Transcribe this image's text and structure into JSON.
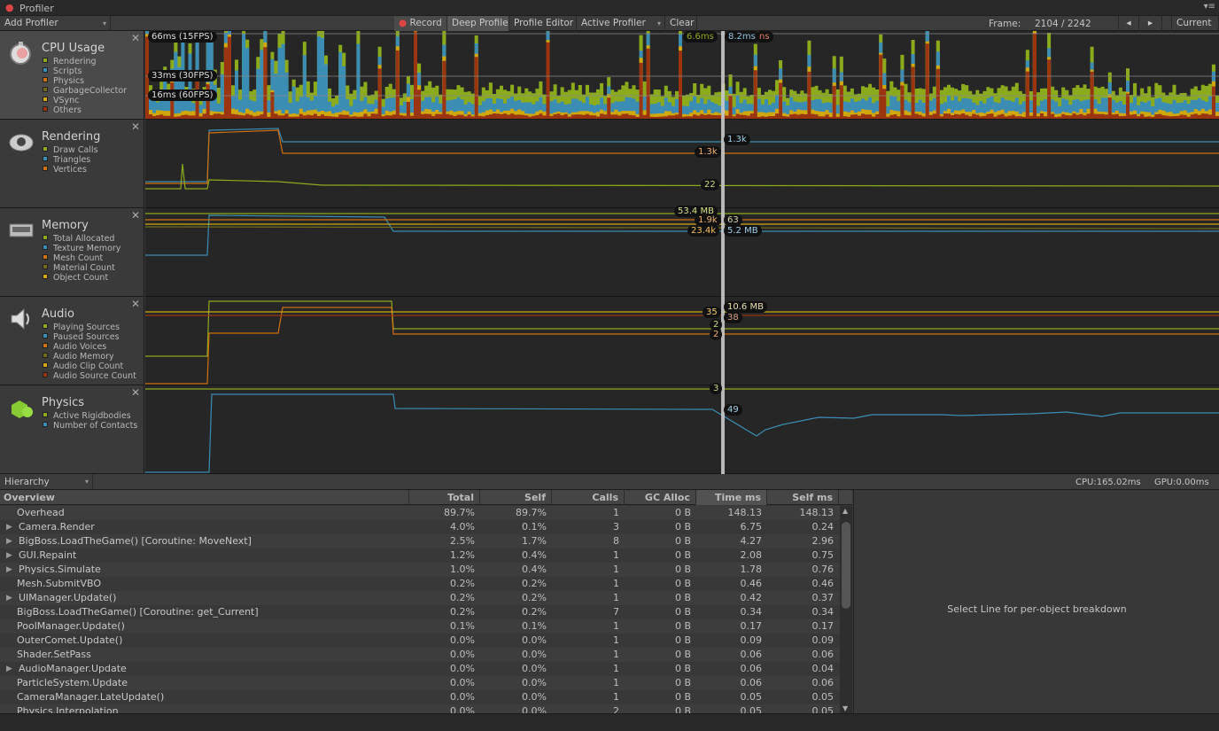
{
  "window": {
    "title": "Profiler"
  },
  "toolbar": {
    "add_profiler": "Add Profiler",
    "record": "Record",
    "deep_profile": "Deep Profile",
    "profile_editor": "Profile Editor",
    "active_profiler": "Active Profiler",
    "clear": "Clear",
    "frame_label": "Frame:",
    "frame_value": "2104 / 2242",
    "current": "Current"
  },
  "colors": {
    "rendering": "#8cab1c",
    "scripts": "#3b8db4",
    "physics": "#d0700f",
    "garbage": "#6f6b1a",
    "vsync": "#d1a80c",
    "others": "#9a3510",
    "cursor": "#c9c9c9"
  },
  "modules": {
    "cpu": {
      "title": "CPU Usage",
      "icon": "stopwatch-icon",
      "legend": [
        "Rendering",
        "Scripts",
        "Physics",
        "GarbageCollector",
        "VSync",
        "Others"
      ],
      "guides": [
        "66ms (15FPS)",
        "33ms (30FPS)",
        "16ms (60FPS)"
      ],
      "cursor_values": [
        "6.6ms",
        "8.2ms",
        "ns"
      ]
    },
    "rendering": {
      "title": "Rendering",
      "icon": "rendering-icon",
      "legend": [
        "Draw Calls",
        "Triangles",
        "Vertices"
      ],
      "cursor_values": [
        "1.3k",
        "1.3k",
        "22"
      ]
    },
    "memory": {
      "title": "Memory",
      "icon": "memory-chip-icon",
      "legend": [
        "Total Allocated",
        "Texture Memory",
        "Mesh Count",
        "Material Count",
        "Object Count"
      ],
      "cursor_values": [
        "53.4 MB",
        "1.9k",
        "63",
        "23.4k",
        "5.2 MB"
      ]
    },
    "audio": {
      "title": "Audio",
      "icon": "speaker-icon",
      "legend": [
        "Playing Sources",
        "Paused Sources",
        "Audio Voices",
        "Audio Memory",
        "Audio Clip Count",
        "Audio Source Count"
      ],
      "cursor_values": [
        "10.6 MB",
        "35",
        "38",
        "2",
        "2"
      ]
    },
    "physics": {
      "title": "Physics",
      "icon": "physics-cube-icon",
      "legend": [
        "Active Rigidbodies",
        "Number of Contacts"
      ],
      "cursor_values": [
        "3",
        "49"
      ]
    }
  },
  "hierarchy": {
    "view": "Hierarchy",
    "cpu": "CPU:165.02ms",
    "gpu": "GPU:0.00ms",
    "columns": [
      "Overview",
      "Total",
      "Self",
      "Calls",
      "GC Alloc",
      "Time ms",
      "Self ms"
    ],
    "sorted_column": "Time ms",
    "rows": [
      {
        "name": "Overhead",
        "expandable": false,
        "total": "89.7%",
        "self": "89.7%",
        "calls": "1",
        "gc": "0 B",
        "time": "148.13",
        "selfms": "148.13"
      },
      {
        "name": "Camera.Render",
        "expandable": true,
        "total": "4.0%",
        "self": "0.1%",
        "calls": "3",
        "gc": "0 B",
        "time": "6.75",
        "selfms": "0.24"
      },
      {
        "name": "BigBoss.LoadTheGame() [Coroutine: MoveNext]",
        "expandable": true,
        "total": "2.5%",
        "self": "1.7%",
        "calls": "8",
        "gc": "0 B",
        "time": "4.27",
        "selfms": "2.96"
      },
      {
        "name": "GUI.Repaint",
        "expandable": true,
        "total": "1.2%",
        "self": "0.4%",
        "calls": "1",
        "gc": "0 B",
        "time": "2.08",
        "selfms": "0.75"
      },
      {
        "name": "Physics.Simulate",
        "expandable": true,
        "total": "1.0%",
        "self": "0.4%",
        "calls": "1",
        "gc": "0 B",
        "time": "1.78",
        "selfms": "0.76"
      },
      {
        "name": "Mesh.SubmitVBO",
        "expandable": false,
        "total": "0.2%",
        "self": "0.2%",
        "calls": "1",
        "gc": "0 B",
        "time": "0.46",
        "selfms": "0.46"
      },
      {
        "name": "UIManager.Update()",
        "expandable": true,
        "total": "0.2%",
        "self": "0.2%",
        "calls": "1",
        "gc": "0 B",
        "time": "0.42",
        "selfms": "0.37"
      },
      {
        "name": "BigBoss.LoadTheGame() [Coroutine: get_Current]",
        "expandable": false,
        "total": "0.2%",
        "self": "0.2%",
        "calls": "7",
        "gc": "0 B",
        "time": "0.34",
        "selfms": "0.34"
      },
      {
        "name": "PoolManager.Update()",
        "expandable": false,
        "total": "0.1%",
        "self": "0.1%",
        "calls": "1",
        "gc": "0 B",
        "time": "0.17",
        "selfms": "0.17"
      },
      {
        "name": "OuterComet.Update()",
        "expandable": false,
        "total": "0.0%",
        "self": "0.0%",
        "calls": "1",
        "gc": "0 B",
        "time": "0.09",
        "selfms": "0.09"
      },
      {
        "name": "Shader.SetPass",
        "expandable": false,
        "total": "0.0%",
        "self": "0.0%",
        "calls": "1",
        "gc": "0 B",
        "time": "0.06",
        "selfms": "0.06"
      },
      {
        "name": "AudioManager.Update",
        "expandable": true,
        "total": "0.0%",
        "self": "0.0%",
        "calls": "1",
        "gc": "0 B",
        "time": "0.06",
        "selfms": "0.04"
      },
      {
        "name": "ParticleSystem.Update",
        "expandable": false,
        "total": "0.0%",
        "self": "0.0%",
        "calls": "1",
        "gc": "0 B",
        "time": "0.06",
        "selfms": "0.06"
      },
      {
        "name": "CameraManager.LateUpdate()",
        "expandable": false,
        "total": "0.0%",
        "self": "0.0%",
        "calls": "1",
        "gc": "0 B",
        "time": "0.05",
        "selfms": "0.05"
      },
      {
        "name": "Physics.Interpolation",
        "expandable": false,
        "total": "0.0%",
        "self": "0.0%",
        "calls": "2",
        "gc": "0 B",
        "time": "0.05",
        "selfms": "0.05"
      }
    ],
    "detail_hint": "Select Line for per-object breakdown"
  }
}
